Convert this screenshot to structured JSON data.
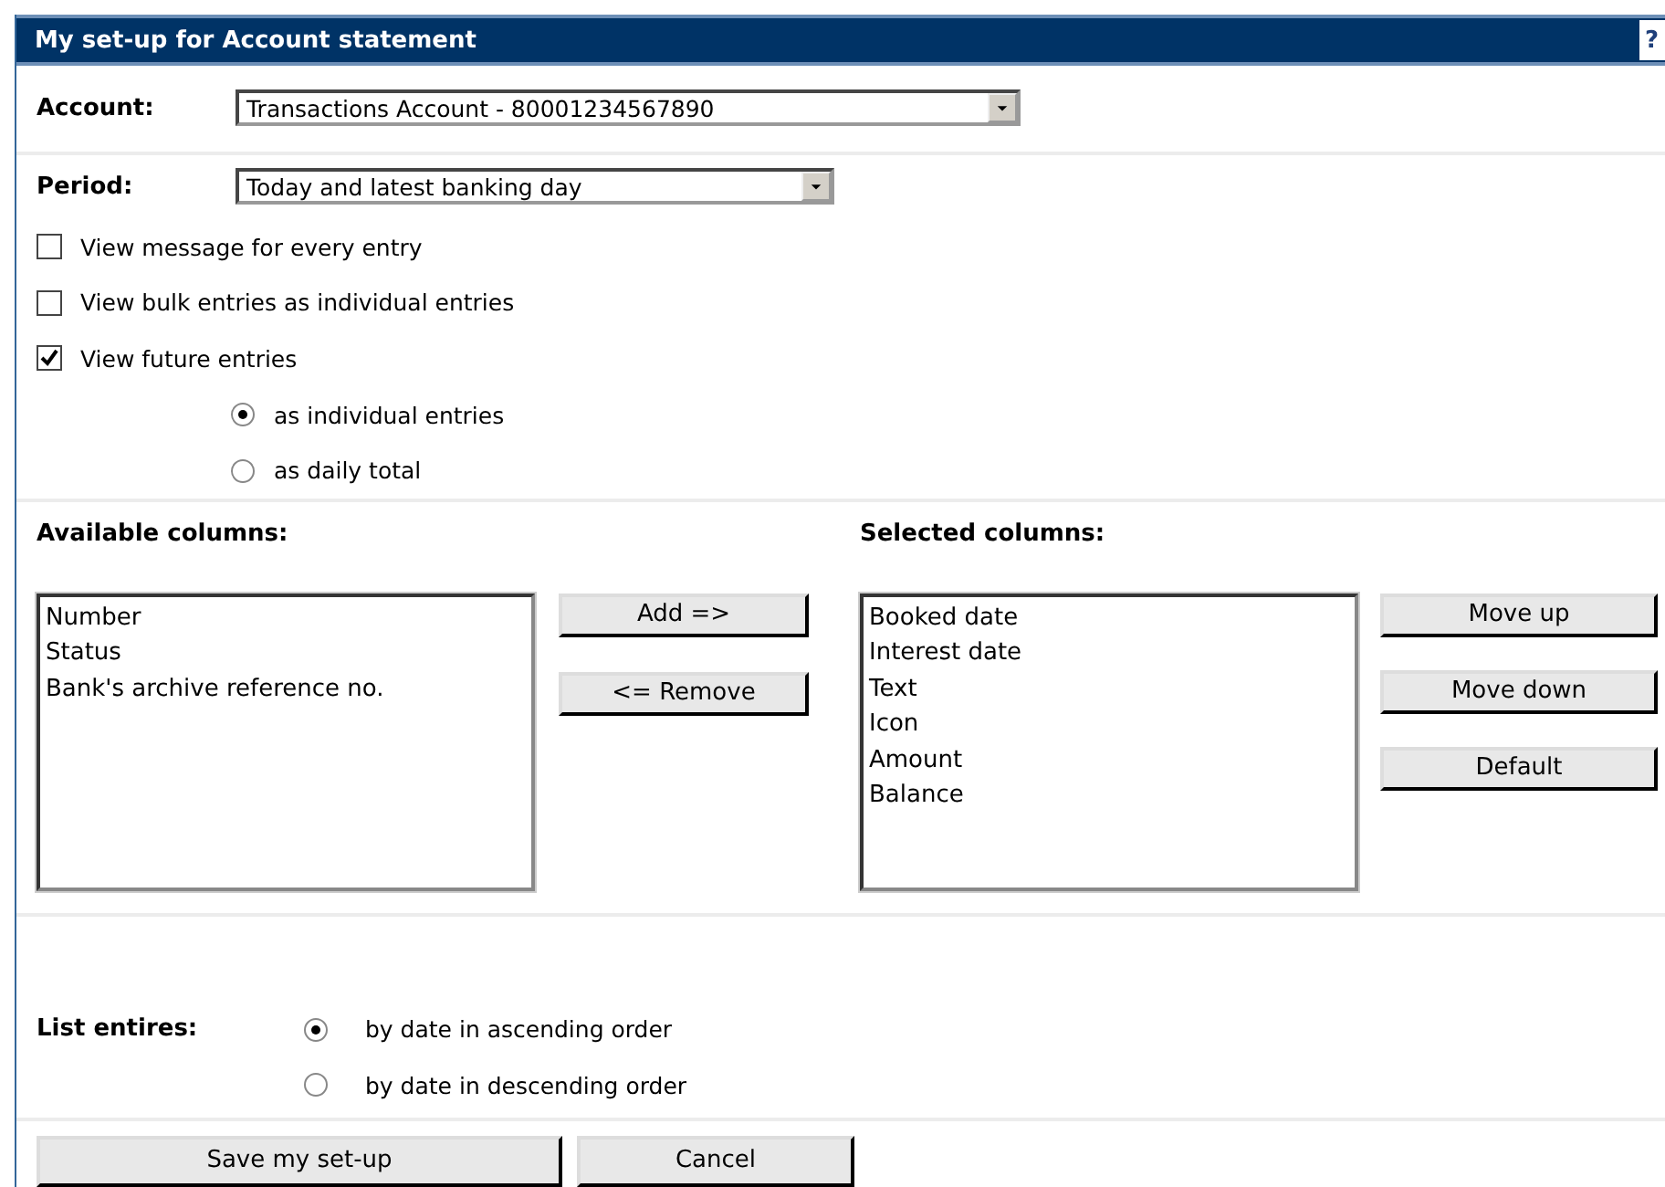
{
  "title": "My set-up for Account statement",
  "help": "?",
  "account": {
    "label": "Account:",
    "value": "Transactions Account - 80001234567890"
  },
  "period": {
    "label": "Period:",
    "value": "Today and latest banking day"
  },
  "options": [
    {
      "label": "View message for every entry",
      "checked": false
    },
    {
      "label": "View bulk entries as individual entries",
      "checked": false
    },
    {
      "label": "View future entries",
      "checked": true
    }
  ],
  "future_display": [
    {
      "label": "as individual entries",
      "selected": true
    },
    {
      "label": "as daily total",
      "selected": false
    }
  ],
  "available_columns": {
    "heading": "Available columns:",
    "items": [
      "Number",
      "Status",
      "Bank's archive reference no."
    ]
  },
  "transfer_buttons": [
    "Add =>",
    "<= Remove"
  ],
  "selected_columns": {
    "heading": "Selected columns:",
    "items": [
      "Booked date",
      "Interest date",
      "Text",
      "Icon",
      "Amount",
      "Balance"
    ]
  },
  "order_buttons": [
    "Move up",
    "Move down",
    "Default"
  ],
  "list_entries": {
    "label": "List entires:",
    "options": [
      {
        "label": "by date in ascending order",
        "selected": true
      },
      {
        "label": "by date in descending order",
        "selected": false
      }
    ]
  },
  "footer_buttons": [
    "Save my set-up",
    "Cancel"
  ]
}
